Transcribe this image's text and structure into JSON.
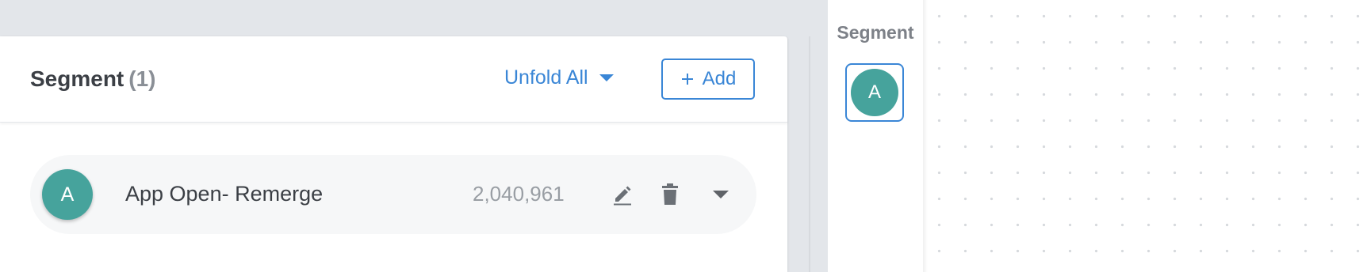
{
  "panel": {
    "title": "Segment",
    "count": "(1)",
    "unfold_label": "Unfold All",
    "add_label": "Add"
  },
  "segments": [
    {
      "letter": "A",
      "name": "App Open- Remerge",
      "count": "2,040,961"
    }
  ],
  "sidebar": {
    "label": "Segment",
    "letter": "A"
  },
  "colors": {
    "accent": "#3a86d6",
    "avatar": "#46a39c",
    "row_bg": "#f6f7f8",
    "page_bg": "#e3e6ea"
  },
  "icons": [
    "caret-down-icon",
    "plus-icon",
    "edit-icon",
    "trash-icon",
    "chevron-down-icon"
  ]
}
